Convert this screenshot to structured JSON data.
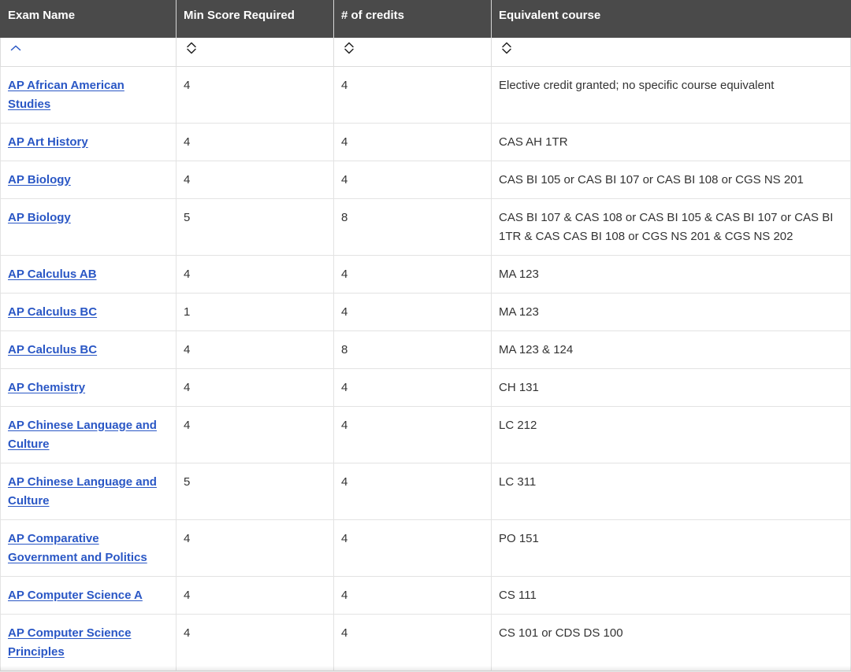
{
  "table": {
    "columns": [
      {
        "key": "exam",
        "label": "Exam Name",
        "sort": "ascending"
      },
      {
        "key": "min_score",
        "label": "Min Score Required",
        "sort": "unsorted"
      },
      {
        "key": "credits",
        "label": "# of credits",
        "sort": "unsorted"
      },
      {
        "key": "equivalent",
        "label": "Equivalent course",
        "sort": "unsorted"
      }
    ],
    "rows": [
      {
        "exam": "AP African American Studies",
        "min_score": "4",
        "credits": "4",
        "equivalent": "Elective credit granted; no specific course equivalent"
      },
      {
        "exam": "AP Art History",
        "min_score": "4",
        "credits": "4",
        "equivalent": "CAS AH 1TR"
      },
      {
        "exam": "AP Biology",
        "min_score": "4",
        "credits": "4",
        "equivalent": "CAS BI 105 or CAS BI 107 or CAS BI 108 or CGS NS 201"
      },
      {
        "exam": "AP Biology",
        "min_score": "5",
        "credits": "8",
        "equivalent": "CAS BI 107 & CAS 108 or CAS BI 105 & CAS BI 107 or CAS BI 1TR & CAS CAS BI 108 or CGS NS 201 & CGS NS 202"
      },
      {
        "exam": "AP Calculus AB",
        "min_score": "4",
        "credits": "4",
        "equivalent": "MA 123"
      },
      {
        "exam": "AP Calculus BC",
        "min_score": "1",
        "credits": "4",
        "equivalent": "MA 123"
      },
      {
        "exam": "AP Calculus BC",
        "min_score": "4",
        "credits": "8",
        "equivalent": "MA 123 & 124"
      },
      {
        "exam": "AP Chemistry",
        "min_score": "4",
        "credits": "4",
        "equivalent": "CH 131"
      },
      {
        "exam": "AP Chinese Language and Culture",
        "min_score": "4",
        "credits": "4",
        "equivalent": "LC 212"
      },
      {
        "exam": "AP Chinese Language and Culture",
        "min_score": "5",
        "credits": "4",
        "equivalent": "LC 311"
      },
      {
        "exam": "AP Comparative Government and Politics",
        "min_score": "4",
        "credits": "4",
        "equivalent": "PO 151"
      },
      {
        "exam": "AP Computer Science A",
        "min_score": "4",
        "credits": "4",
        "equivalent": "CS 111"
      },
      {
        "exam": "AP Computer Science Principles",
        "min_score": "4",
        "credits": "4",
        "equivalent": "CS 101 or CDS DS 100"
      }
    ]
  },
  "colors": {
    "header_bg": "#4a4a4a",
    "header_text": "#ffffff",
    "link": "#2a57c5",
    "border": "#e3e3e3"
  },
  "icons": {
    "sorted_asc": "chevron-up-icon",
    "unsorted": "sort-toggle-icon"
  }
}
